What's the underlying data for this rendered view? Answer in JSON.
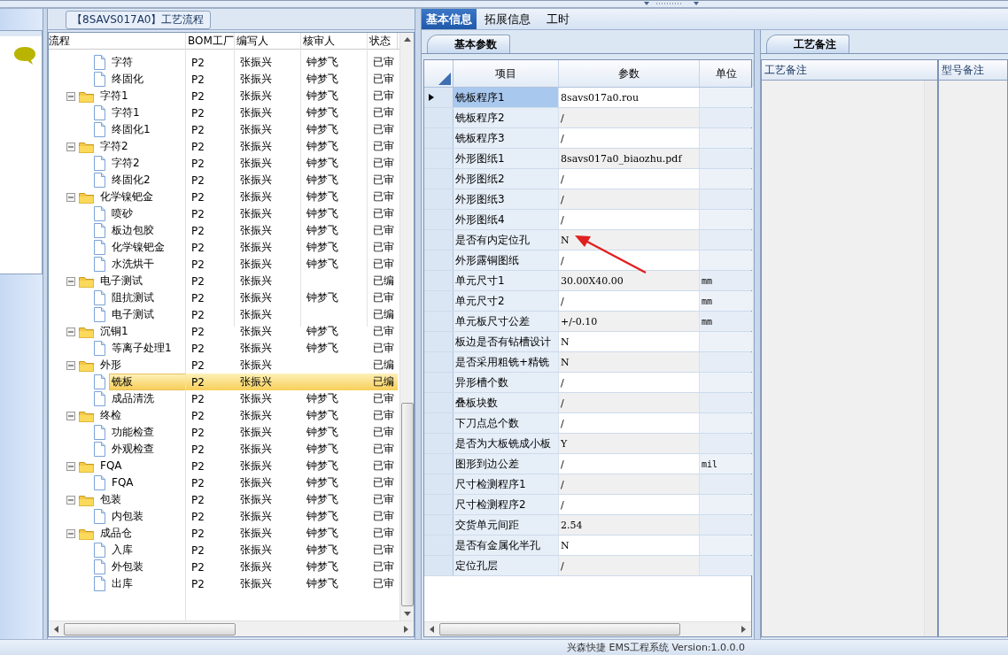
{
  "process_panel": {
    "title": "【8SAVS017A0】工艺流程",
    "columns": [
      "流程",
      "BOM工厂",
      "编写人",
      "核审人",
      "状态"
    ],
    "nodes": [
      {
        "children": [
          {
            "label": "字符",
            "factory": "P2",
            "writer": "张振兴",
            "reviewer": "钟梦飞",
            "status": "已审",
            "selected": false
          },
          {
            "label": "终固化",
            "factory": "P2",
            "writer": "张振兴",
            "reviewer": "钟梦飞",
            "status": "已审",
            "selected": false
          }
        ]
      },
      {
        "label": "字符1",
        "factory": "P2",
        "writer": "张振兴",
        "reviewer": "钟梦飞",
        "status": "已审",
        "selected": false,
        "expanded": true,
        "children": [
          {
            "label": "字符1",
            "factory": "P2",
            "writer": "张振兴",
            "reviewer": "钟梦飞",
            "status": "已审",
            "selected": false
          },
          {
            "label": "终固化1",
            "factory": "P2",
            "writer": "张振兴",
            "reviewer": "钟梦飞",
            "status": "已审",
            "selected": false
          }
        ]
      },
      {
        "label": "字符2",
        "factory": "P2",
        "writer": "张振兴",
        "reviewer": "钟梦飞",
        "status": "已审",
        "selected": false,
        "expanded": true,
        "children": [
          {
            "label": "字符2",
            "factory": "P2",
            "writer": "张振兴",
            "reviewer": "钟梦飞",
            "status": "已审",
            "selected": false
          },
          {
            "label": "终固化2",
            "factory": "P2",
            "writer": "张振兴",
            "reviewer": "钟梦飞",
            "status": "已审",
            "selected": false
          }
        ]
      },
      {
        "label": "化学镍钯金",
        "factory": "P2",
        "writer": "张振兴",
        "reviewer": "钟梦飞",
        "status": "已审",
        "selected": false,
        "expanded": true,
        "children": [
          {
            "label": "喷砂",
            "factory": "P2",
            "writer": "张振兴",
            "reviewer": "钟梦飞",
            "status": "已审",
            "selected": false
          },
          {
            "label": "板边包胶",
            "factory": "P2",
            "writer": "张振兴",
            "reviewer": "钟梦飞",
            "status": "已审",
            "selected": false
          },
          {
            "label": "化学镍钯金",
            "factory": "P2",
            "writer": "张振兴",
            "reviewer": "钟梦飞",
            "status": "已审",
            "selected": false
          },
          {
            "label": "水洗烘干",
            "factory": "P2",
            "writer": "张振兴",
            "reviewer": "钟梦飞",
            "status": "已审",
            "selected": false
          }
        ]
      },
      {
        "label": "电子测试",
        "factory": "P2",
        "writer": "张振兴",
        "status": "已编",
        "selected": false,
        "expanded": true,
        "children": [
          {
            "label": "阻抗测试",
            "factory": "P2",
            "writer": "张振兴",
            "reviewer": "钟梦飞",
            "status": "已审",
            "selected": false
          },
          {
            "label": "电子测试",
            "factory": "P2",
            "writer": "张振兴",
            "status": "已编",
            "selected": false
          }
        ]
      },
      {
        "label": "沉铜1",
        "factory": "P2",
        "writer": "张振兴",
        "reviewer": "钟梦飞",
        "status": "已审",
        "selected": false,
        "expanded": true,
        "children": [
          {
            "label": "等离子处理1",
            "factory": "P2",
            "writer": "张振兴",
            "reviewer": "钟梦飞",
            "status": "已审",
            "selected": false
          }
        ]
      },
      {
        "label": "外形",
        "factory": "P2",
        "writer": "张振兴",
        "status": "已编",
        "selected": false,
        "expanded": true,
        "children": [
          {
            "label": "铣板",
            "factory": "P2",
            "writer": "张振兴",
            "status": "已编",
            "selected": true
          },
          {
            "label": "成品清洗",
            "factory": "P2",
            "writer": "张振兴",
            "reviewer": "钟梦飞",
            "status": "已审",
            "selected": false
          }
        ]
      },
      {
        "label": "终检",
        "factory": "P2",
        "writer": "张振兴",
        "reviewer": "钟梦飞",
        "status": "已审",
        "selected": false,
        "expanded": true,
        "children": [
          {
            "label": "功能检查",
            "factory": "P2",
            "writer": "张振兴",
            "reviewer": "钟梦飞",
            "status": "已审",
            "selected": false
          },
          {
            "label": "外观检查",
            "factory": "P2",
            "writer": "张振兴",
            "reviewer": "钟梦飞",
            "status": "已审",
            "selected": false
          }
        ]
      },
      {
        "label": "FQA",
        "factory": "P2",
        "writer": "张振兴",
        "reviewer": "钟梦飞",
        "status": "已审",
        "selected": false,
        "expanded": true,
        "children": [
          {
            "label": "FQA",
            "factory": "P2",
            "writer": "张振兴",
            "reviewer": "钟梦飞",
            "status": "已审",
            "selected": false
          }
        ]
      },
      {
        "label": "包装",
        "factory": "P2",
        "writer": "张振兴",
        "reviewer": "钟梦飞",
        "status": "已审",
        "selected": false,
        "expanded": true,
        "children": [
          {
            "label": "内包装",
            "factory": "P2",
            "writer": "张振兴",
            "reviewer": "钟梦飞",
            "status": "已审",
            "selected": false
          }
        ]
      },
      {
        "label": "成品仓",
        "factory": "P2",
        "writer": "张振兴",
        "reviewer": "钟梦飞",
        "status": "已审",
        "selected": false,
        "expanded": true,
        "children": [
          {
            "label": "入库",
            "factory": "P2",
            "writer": "张振兴",
            "reviewer": "钟梦飞",
            "status": "已审",
            "selected": false
          },
          {
            "label": "外包装",
            "factory": "P2",
            "writer": "张振兴",
            "reviewer": "钟梦飞",
            "status": "已审",
            "selected": false
          },
          {
            "label": "出库",
            "factory": "P2",
            "writer": "张振兴",
            "reviewer": "钟梦飞",
            "status": "已审",
            "selected": false
          }
        ]
      }
    ]
  },
  "tabs": [
    {
      "label": "基本信息",
      "selected": true
    },
    {
      "label": "拓展信息",
      "selected": false
    },
    {
      "label": "工时",
      "selected": false
    }
  ],
  "params_panel": {
    "tab": "基本参数",
    "columns": [
      "项目",
      "参数",
      "单位"
    ],
    "rows": [
      {
        "item": "铣板程序1",
        "value": "8savs017a0.rou",
        "selected": true
      },
      {
        "item": "铣板程序2",
        "value": "/",
        "selected": false
      },
      {
        "item": "铣板程序3",
        "value": "/",
        "selected": false
      },
      {
        "item": "外形图纸1",
        "value": "8savs017a0_biaozhu.pdf",
        "selected": false
      },
      {
        "item": "外形图纸2",
        "value": "/",
        "selected": false
      },
      {
        "item": "外形图纸3",
        "value": "/",
        "selected": false
      },
      {
        "item": "外形图纸4",
        "value": "/",
        "selected": false
      },
      {
        "item": "是否有内定位孔",
        "value": "N",
        "selected": false
      },
      {
        "item": "外形露铜图纸",
        "value": "/",
        "selected": false
      },
      {
        "item": "单元尺寸1",
        "value": "30.00X40.00",
        "unit": "mm",
        "selected": false
      },
      {
        "item": "单元尺寸2",
        "value": "/",
        "unit": "mm",
        "selected": false
      },
      {
        "item": "单元板尺寸公差",
        "value": "+/-0.10",
        "unit": "mm",
        "selected": false
      },
      {
        "item": "板边是否有钻槽设计",
        "value": "N",
        "selected": false
      },
      {
        "item": "是否采用粗铣+精铣",
        "value": "N",
        "selected": false
      },
      {
        "item": "异形槽个数",
        "value": "/",
        "selected": false
      },
      {
        "item": "叠板块数",
        "value": "/",
        "selected": false
      },
      {
        "item": "下刀点总个数",
        "value": "/",
        "selected": false
      },
      {
        "item": "是否为大板铣成小板",
        "value": "Y",
        "selected": false
      },
      {
        "item": "图形到边公差",
        "value": "/",
        "unit": "mil",
        "selected": false
      },
      {
        "item": "尺寸检测程序1",
        "value": "/",
        "selected": false
      },
      {
        "item": "尺寸检测程序2",
        "value": "/",
        "selected": false
      },
      {
        "item": "交货单元间距",
        "value": "2.54",
        "selected": false
      },
      {
        "item": "是否有金属化半孔",
        "value": "N",
        "selected": false
      },
      {
        "item": "定位孔层",
        "value": "/",
        "selected": false
      }
    ]
  },
  "notes_panel": {
    "tab": "工艺备注",
    "columns": [
      "工艺备注",
      "型号备注"
    ]
  },
  "status_bar": {
    "text": "兴森快捷 EMS工程系统 Version:1.0.0.0"
  }
}
